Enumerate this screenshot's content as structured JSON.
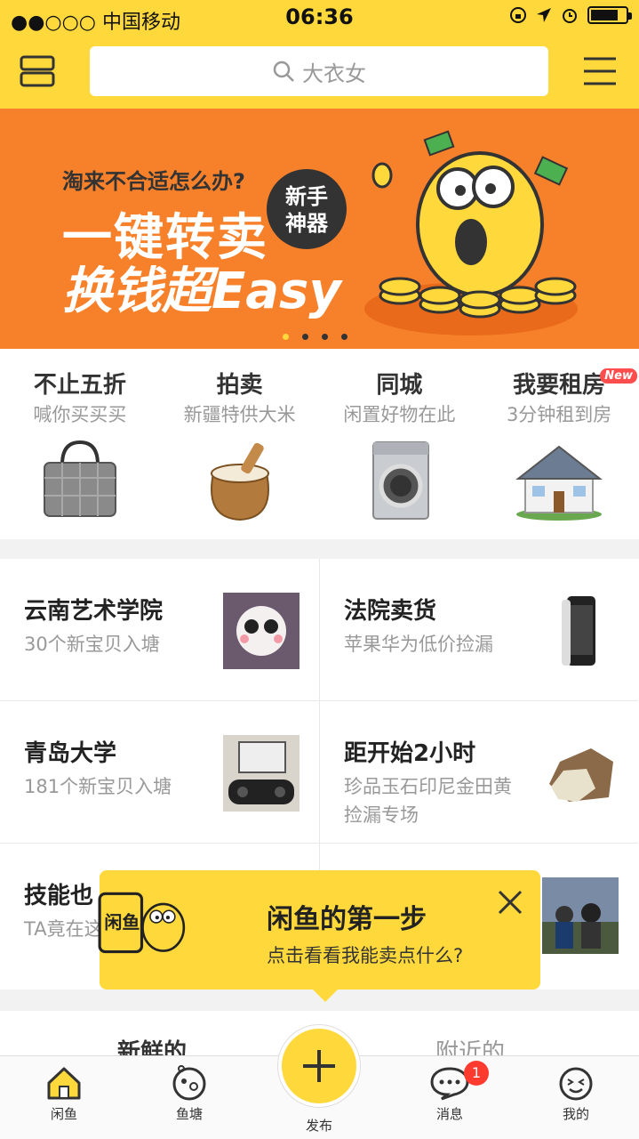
{
  "status": {
    "carrier": "●●○○○ 中国移动",
    "time": "06:36"
  },
  "search": {
    "placeholder": "大衣女"
  },
  "banner": {
    "question": "淘来不合适怎么办?",
    "line1": "一键转卖",
    "line2": "换钱超Easy",
    "badge": "新手神器",
    "page_count": 4,
    "active_page": 1
  },
  "categories": [
    {
      "title": "不止五折",
      "subtitle": "喊你买买买",
      "icon": "handbag-icon"
    },
    {
      "title": "拍卖",
      "subtitle": "新疆特供大米",
      "icon": "rice-sack-icon"
    },
    {
      "title": "同城",
      "subtitle": "闲置好物在此",
      "icon": "washing-machine-icon"
    },
    {
      "title": "我要租房",
      "subtitle": "3分钟租到房",
      "icon": "house-icon",
      "tag": "New"
    }
  ],
  "grid": [
    {
      "title": "云南艺术学院",
      "subtitle": "30个新宝贝入塘"
    },
    {
      "title": "法院卖货",
      "subtitle": "苹果华为低价捡漏"
    },
    {
      "title": "青岛大学",
      "subtitle": "181个新宝贝入塘"
    },
    {
      "title": "距开始2小时",
      "subtitle": "珍品玉石印尼金田黄捡漏专场"
    },
    {
      "title": "技能也",
      "subtitle": "TA竟在这 师"
    },
    {
      "title": "",
      "subtitle": ""
    }
  ],
  "popup": {
    "logo": "闲鱼",
    "title": "闲鱼的第一步",
    "subtitle": "点击看看我能卖点什么?"
  },
  "feed_tabs": {
    "left": "新鲜的",
    "right": "附近的"
  },
  "nav": {
    "home": "闲鱼",
    "pond": "鱼塘",
    "publish": "发布",
    "messages": "消息",
    "messages_badge": "1",
    "mine": "我的"
  },
  "colors": {
    "brand_yellow": "#ffd93b",
    "banner_orange": "#f7812b",
    "badge_red": "#ff3b30"
  }
}
